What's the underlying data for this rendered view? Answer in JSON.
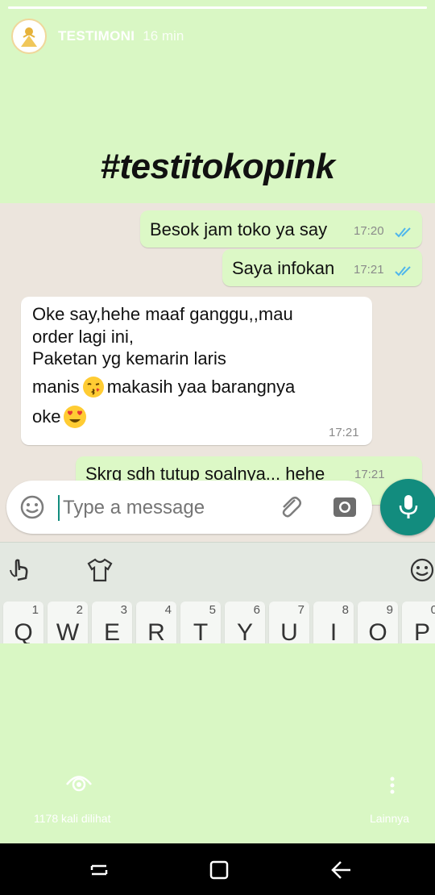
{
  "story": {
    "user": "TESTIMONI",
    "time_ago": "16 min",
    "title": "#testitokopink",
    "progress": 1.0
  },
  "chat": {
    "messages": [
      {
        "direction": "out",
        "text": "Besok jam toko ya say",
        "time": "17:20",
        "read": true
      },
      {
        "direction": "out",
        "text": "Saya infokan",
        "time": "17:21",
        "read": true
      },
      {
        "direction": "in",
        "lines": [
          "Oke say,hehe maaf ganggu,,mau",
          "order lagi ini,",
          "Paketan yg kemarin laris",
          "manis",
          "makasih yaa barangnya",
          "oke"
        ],
        "time": "17:21"
      },
      {
        "direction": "out",
        "text": "Skrg sdh tutup soalnya... hehe",
        "time": "17:21"
      }
    ],
    "input_placeholder": "Type a message"
  },
  "keyboard": {
    "keys": [
      {
        "num": "1",
        "ch": "Q"
      },
      {
        "num": "2",
        "ch": "W"
      },
      {
        "num": "3",
        "ch": "E"
      },
      {
        "num": "4",
        "ch": "R"
      },
      {
        "num": "5",
        "ch": "T"
      },
      {
        "num": "6",
        "ch": "Y"
      },
      {
        "num": "7",
        "ch": "U"
      },
      {
        "num": "8",
        "ch": "I"
      },
      {
        "num": "9",
        "ch": "O"
      },
      {
        "num": "0",
        "ch": "P"
      }
    ]
  },
  "footer": {
    "views": "1178 kali dilihat",
    "more": "Lainnya"
  },
  "colors": {
    "story_bg": "#d9f7c4",
    "chat_bg": "#ece5dd",
    "outgoing_bubble": "#dcf8c6",
    "read_ticks": "#4fb6ec",
    "mic_button": "#128c7e"
  },
  "icons": [
    "avatar-icon",
    "emoji-icon",
    "attach-icon",
    "camera-icon",
    "mic-icon",
    "gesture-icon",
    "shirt-icon",
    "smiley-icon",
    "eye-icon",
    "more-icon",
    "nav-recents-icon",
    "nav-home-icon",
    "nav-back-icon"
  ]
}
